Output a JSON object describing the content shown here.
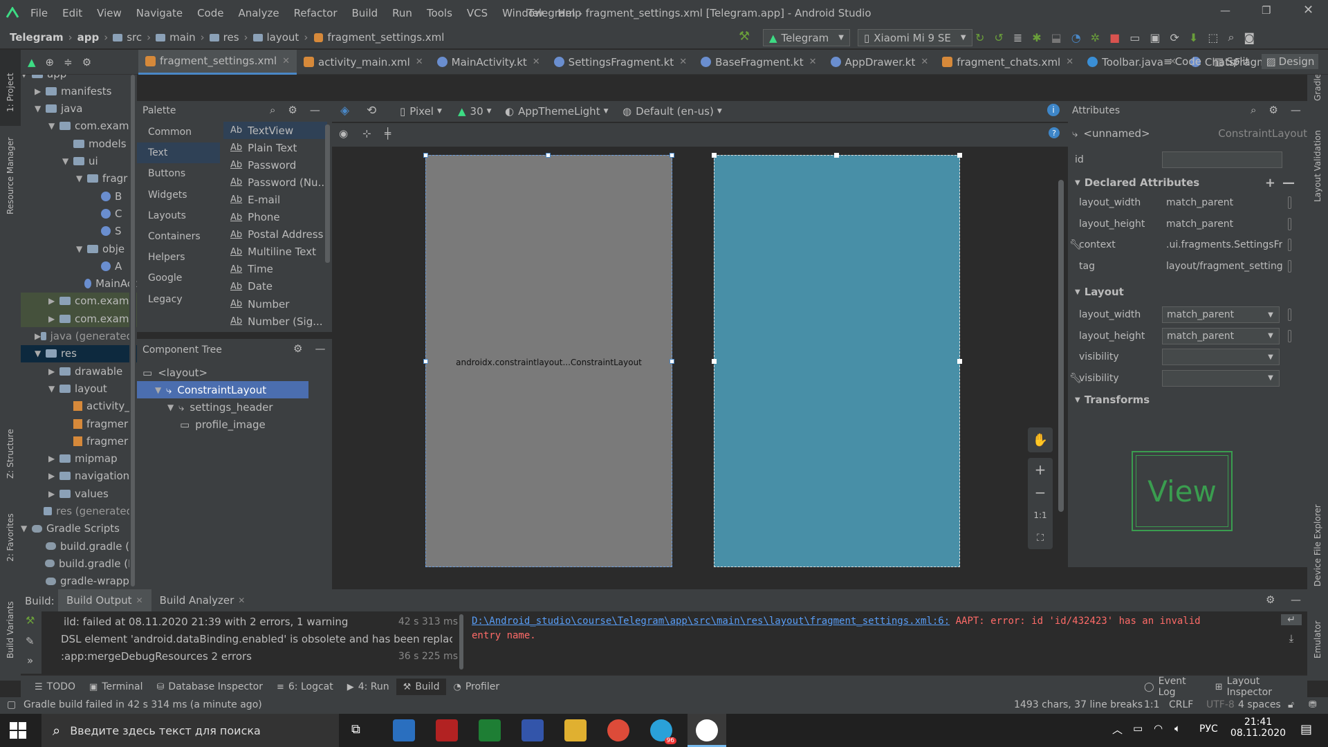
{
  "titlebar": {
    "menu": [
      "File",
      "Edit",
      "View",
      "Navigate",
      "Code",
      "Analyze",
      "Refactor",
      "Build",
      "Run",
      "Tools",
      "VCS",
      "Window",
      "Help"
    ],
    "title": "Telegram - fragment_settings.xml [Telegram.app] - Android Studio"
  },
  "breadcrumb": [
    "Telegram",
    "app",
    "src",
    "main",
    "res",
    "layout",
    "fragment_settings.xml"
  ],
  "run_config": {
    "module": "Telegram",
    "device": "Xiaomi Mi 9 SE"
  },
  "tabs": [
    {
      "label": "fragment_settings.xml",
      "type": "xml"
    },
    {
      "label": "activity_main.xml",
      "type": "xml"
    },
    {
      "label": "MainActivity.kt",
      "type": "kt"
    },
    {
      "label": "SettingsFragment.kt",
      "type": "kt"
    },
    {
      "label": "BaseFragment.kt",
      "type": "kt"
    },
    {
      "label": "AppDrawer.kt",
      "type": "kt"
    },
    {
      "label": "fragment_chats.xml",
      "type": "xml"
    },
    {
      "label": "Toolbar.java",
      "type": "java"
    },
    {
      "label": "ChatsFragment.kt",
      "type": "kt"
    }
  ],
  "view_modes": {
    "code": "Code",
    "split": "Split",
    "design": "Design"
  },
  "left_stripe": {
    "project": "1: Project",
    "resource_manager": "Resource Manager",
    "structure": "Z: Structure",
    "favorites": "2: Favorites",
    "build_variants": "Build Variants"
  },
  "right_stripe": {
    "gradle": "Gradle",
    "layout_validation": "Layout Validation",
    "device_file_explorer": "Device File Explorer",
    "emulator": "Emulator"
  },
  "project_tree": [
    {
      "label": "app",
      "level": 0,
      "kind": "module",
      "open": true
    },
    {
      "label": "manifests",
      "level": 1,
      "kind": "folder",
      "open": false
    },
    {
      "label": "java",
      "level": 1,
      "kind": "folder",
      "open": true
    },
    {
      "label": "com.examp",
      "level": 2,
      "kind": "folder",
      "open": true
    },
    {
      "label": "models",
      "level": 3,
      "kind": "folder",
      "open": null
    },
    {
      "label": "ui",
      "level": 3,
      "kind": "folder",
      "open": true
    },
    {
      "label": "fragr",
      "level": 4,
      "kind": "folder",
      "open": true
    },
    {
      "label": "B",
      "level": 5,
      "kind": "kt",
      "open": null
    },
    {
      "label": "C",
      "level": 5,
      "kind": "kt",
      "open": null
    },
    {
      "label": "S",
      "level": 5,
      "kind": "kt",
      "open": null
    },
    {
      "label": "obje",
      "level": 4,
      "kind": "folder",
      "open": true
    },
    {
      "label": "A",
      "level": 5,
      "kind": "kt",
      "open": null
    },
    {
      "label": "MainAct",
      "level": 4,
      "kind": "kt",
      "open": null
    },
    {
      "label": "com.examp",
      "level": 2,
      "kind": "folder",
      "open": false
    },
    {
      "label": "com.examp",
      "level": 2,
      "kind": "folder",
      "open": false
    },
    {
      "label": "java (generated)",
      "level": 1,
      "kind": "folder",
      "open": false
    },
    {
      "label": "res",
      "level": 1,
      "kind": "folder",
      "open": true
    },
    {
      "label": "drawable",
      "level": 2,
      "kind": "folder",
      "open": false
    },
    {
      "label": "layout",
      "level": 2,
      "kind": "folder",
      "open": true
    },
    {
      "label": "activity_",
      "level": 3,
      "kind": "xml",
      "open": null
    },
    {
      "label": "fragmer",
      "level": 3,
      "kind": "xml",
      "open": null
    },
    {
      "label": "fragmer",
      "level": 3,
      "kind": "xml",
      "open": null
    },
    {
      "label": "mipmap",
      "level": 2,
      "kind": "folder",
      "open": false
    },
    {
      "label": "navigation",
      "level": 2,
      "kind": "folder",
      "open": false
    },
    {
      "label": "values",
      "level": 2,
      "kind": "folder",
      "open": false
    },
    {
      "label": "res (generated)",
      "level": 1,
      "kind": "folder",
      "open": null
    },
    {
      "label": "Gradle Scripts",
      "level": 0,
      "kind": "gradle",
      "open": true
    },
    {
      "label": "build.gradle (P",
      "level": 1,
      "kind": "gradle",
      "open": null
    },
    {
      "label": "build.gradle (M",
      "level": 1,
      "kind": "gradle",
      "open": null
    },
    {
      "label": "gradle-wrappe",
      "level": 1,
      "kind": "gradle",
      "open": null
    }
  ],
  "palette": {
    "title": "Palette",
    "categories": [
      "Common",
      "Text",
      "Buttons",
      "Widgets",
      "Layouts",
      "Containers",
      "Helpers",
      "Google",
      "Legacy"
    ],
    "selected_category": "Text",
    "items": [
      "TextView",
      "Plain Text",
      "Password",
      "Password (Nu...",
      "E-mail",
      "Phone",
      "Postal Address",
      "Multiline Text",
      "Time",
      "Date",
      "Number",
      "Number (Sig..."
    ],
    "item_prefix": "Ab"
  },
  "component_tree": {
    "title": "Component Tree",
    "nodes": [
      {
        "label": "<layout>",
        "level": 0
      },
      {
        "label": "ConstraintLayout",
        "level": 1
      },
      {
        "label": "settings_header",
        "level": 2
      },
      {
        "label": "profile_image",
        "level": 3
      }
    ]
  },
  "design_toolbar": {
    "device": "Pixel",
    "api": "30",
    "theme": "AppThemeLight",
    "locale": "Default (en-us)"
  },
  "canvas": {
    "blueprint_label": "androidx.constraintlayout...ConstraintLayout"
  },
  "zoom_controls": {
    "one_to_one": "1:1"
  },
  "attributes": {
    "title": "Attributes",
    "component": "<unnamed>",
    "component_class": "ConstraintLayout",
    "id_label": "id",
    "id_value": "",
    "declared_section": "Declared Attributes",
    "declared": [
      {
        "name": "layout_width",
        "value": "match_parent",
        "dropdown": true
      },
      {
        "name": "layout_height",
        "value": "match_parent",
        "dropdown": true
      },
      {
        "name": "context",
        "value": ".ui.fragments.SettingsFrag",
        "dropdown": false
      },
      {
        "name": "tag",
        "value": "layout/fragment_settings",
        "dropdown": false
      }
    ],
    "layout_section": "Layout",
    "layout": [
      {
        "name": "layout_width",
        "value": "match_parent"
      },
      {
        "name": "layout_height",
        "value": "match_parent"
      },
      {
        "name": "visibility",
        "value": ""
      },
      {
        "name": "visibility",
        "value": ""
      }
    ],
    "transforms_section": "Transforms",
    "view_preview": "View"
  },
  "build": {
    "label": "Build:",
    "tabs": [
      "Build Output",
      "Build Analyzer"
    ],
    "entries": [
      {
        "text": "ild: failed at 08.11.2020 21:39 with 2 errors, 1 warning",
        "time": "42 s 313 ms"
      },
      {
        "text": "DSL element 'android.dataBinding.enabled' is obsolete and has been replaced with 'and",
        "time": ""
      },
      {
        "text": ":app:mergeDebugResources  2 errors",
        "time": "36 s 225 ms"
      }
    ],
    "error_path": "D:\\Android_studio\\course\\Telegram\\app\\src\\main\\res\\layout\\fragment_settings.xml:6:",
    "error_msg": " AAPT: error: id 'id/432423' has an invalid",
    "error_msg2": "entry name."
  },
  "tool_windows": [
    "TODO",
    "Terminal",
    "Database Inspector",
    "6: Logcat",
    "4: Run",
    "Build",
    "Profiler"
  ],
  "tool_windows_right": [
    "Event Log",
    "Layout Inspector"
  ],
  "status": {
    "message": "Gradle build failed in 42 s 314 ms (a minute ago)",
    "chars": "1493 chars, 37 line breaks",
    "pos": "1:1",
    "eol": "CRLF",
    "enc": "UTF-8",
    "indent": "4 spaces"
  },
  "taskbar": {
    "search_placeholder": "Введите здесь текст для поиска",
    "lang": "РУС",
    "time": "21:41",
    "date": "08.11.2020",
    "telegram_badge": "96"
  }
}
